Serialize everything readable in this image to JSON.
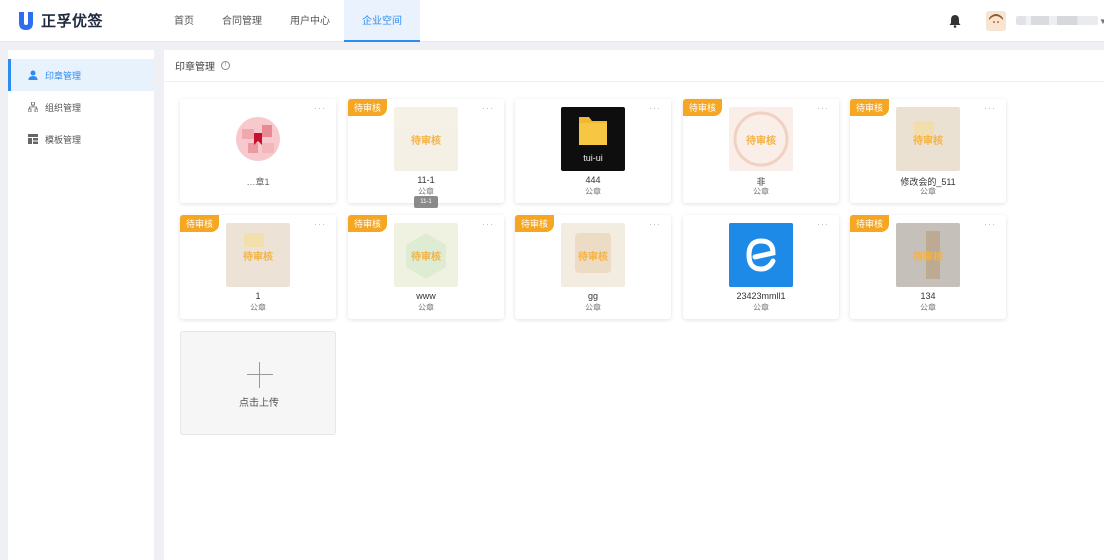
{
  "app": {
    "name": "正孚优签"
  },
  "nav": {
    "items": [
      "首页",
      "合同管理",
      "用户中心",
      "企业空间"
    ],
    "active_index": 3
  },
  "sidebar": {
    "items": [
      {
        "label": "印章管理",
        "icon": "user-icon"
      },
      {
        "label": "组织管理",
        "icon": "org-tree-icon"
      },
      {
        "label": "模板管理",
        "icon": "template-grid-icon"
      }
    ]
  },
  "main": {
    "title": "印章管理"
  },
  "cards": [
    {
      "name": "…章1",
      "type": "",
      "pending": false,
      "thumb": "red-stamp"
    },
    {
      "name": "11-1",
      "type": "公章",
      "pending": true,
      "badge": "待审核",
      "thumb_label": "待审核"
    },
    {
      "name": "444",
      "type": "公章",
      "pending": false,
      "thumb": "folder-dark",
      "thumb_caption": "tui-ui"
    },
    {
      "name": "非",
      "type": "公章",
      "pending": true,
      "badge": "待审核",
      "thumb_label": "待审核"
    },
    {
      "name": "修改会的_511",
      "type": "公章",
      "pending": true,
      "badge": "待审核",
      "thumb_label": "待审核"
    },
    {
      "name": "1",
      "type": "公章",
      "pending": true,
      "badge": "待审核",
      "thumb_label": "待审核"
    },
    {
      "name": "www",
      "type": "公章",
      "pending": true,
      "badge": "待审核",
      "thumb_label": "待审核"
    },
    {
      "name": "gg",
      "type": "公章",
      "pending": true,
      "badge": "待审核",
      "thumb_label": "待审核"
    },
    {
      "name": "23423mmll1",
      "type": "公章",
      "pending": false,
      "thumb": "blue-e-logo"
    },
    {
      "name": "134",
      "type": "公章",
      "pending": true,
      "badge": "待审核",
      "thumb_label": "待审核"
    }
  ],
  "tooltip": {
    "text": "11-1"
  },
  "upload": {
    "label": "点击上传"
  },
  "colors": {
    "accent": "#2d8cf0",
    "badge": "#f5a623"
  }
}
